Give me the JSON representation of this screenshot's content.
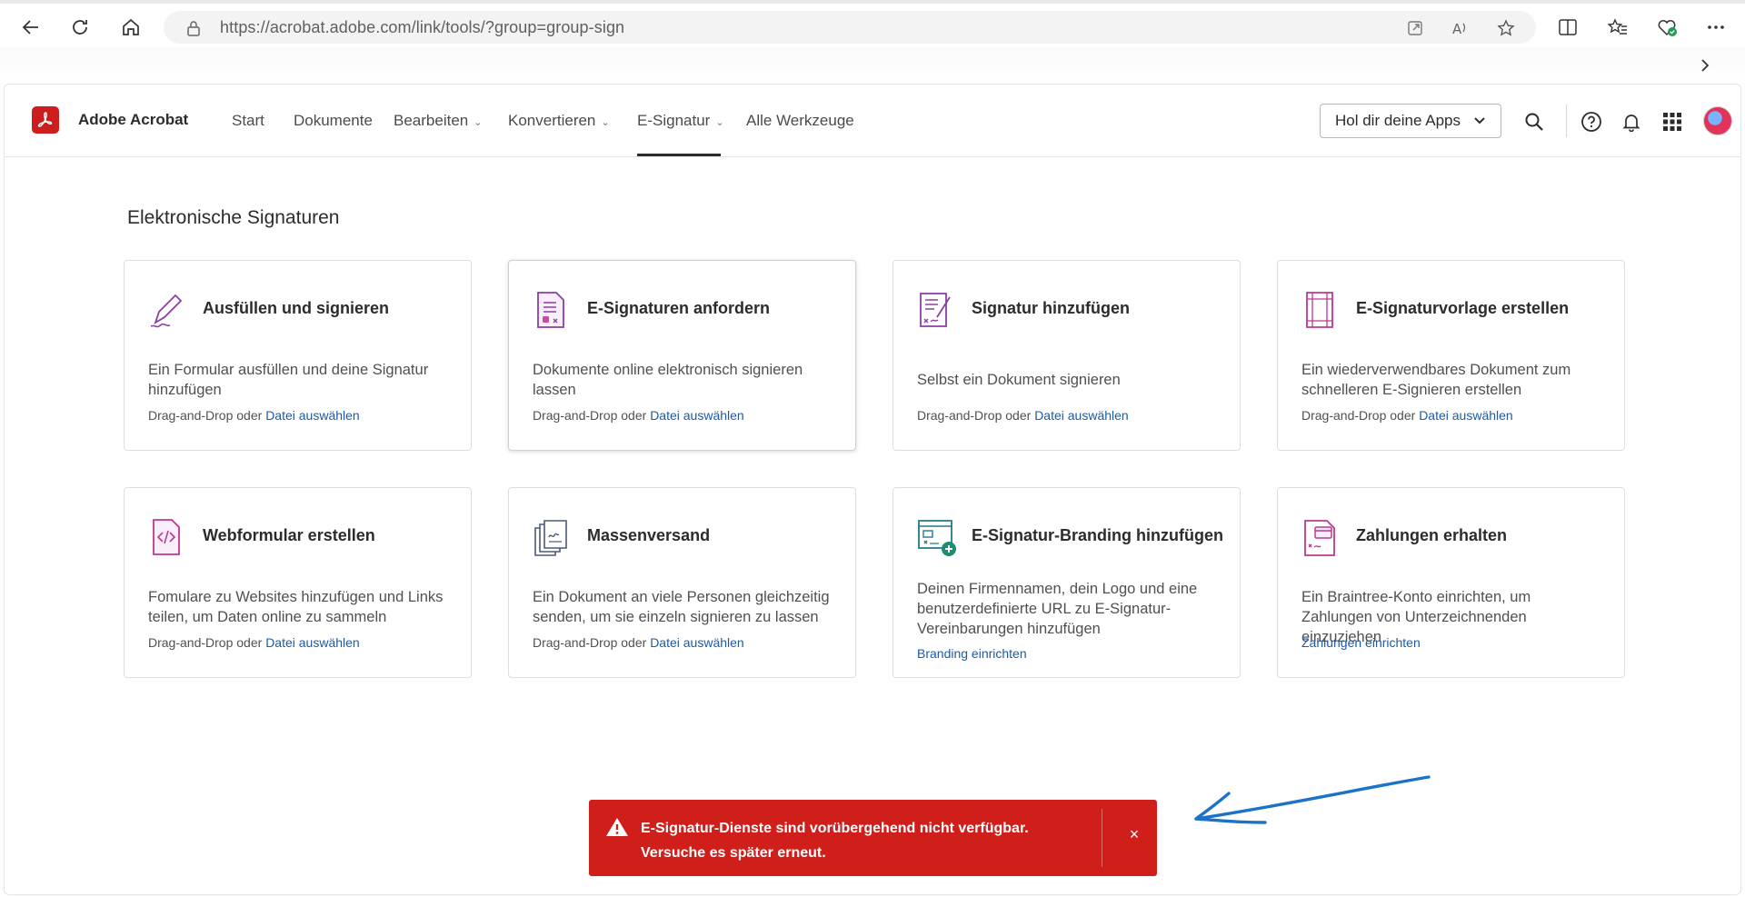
{
  "browser": {
    "url": "https://acrobat.adobe.com/link/tools/?group=group-sign"
  },
  "header": {
    "brand": "Adobe Acrobat",
    "menu": [
      {
        "label": "Start"
      },
      {
        "label": "Dokumente"
      },
      {
        "label": "Bearbeiten"
      },
      {
        "label": "Konvertieren"
      },
      {
        "label": "E-Signatur"
      },
      {
        "label": "Alle Werkzeuge"
      }
    ],
    "active_menu": "E-Signatur",
    "apps_button": "Hol dir deine Apps"
  },
  "main": {
    "section_title": "Elektronische Signaturen",
    "drag_text": "Drag-and-Drop oder",
    "cards": [
      {
        "title": "Ausfüllen und signieren",
        "desc": "Ein Formular ausfüllen und deine Signatur hinzufügen",
        "link": "Datei auswählen",
        "icon": "pen-sign-icon"
      },
      {
        "title": "E-Signaturen anfordern",
        "desc": "Dokumente online elektronisch signieren lassen",
        "link": "Datei auswählen",
        "icon": "request-signature-icon"
      },
      {
        "title": "Signatur hinzufügen",
        "desc": "Selbst ein Dokument signieren",
        "link": "Datei auswählen",
        "icon": "add-signature-icon"
      },
      {
        "title": "E-Signaturvorlage erstellen",
        "desc": "Ein wiederverwendbares Dokument zum schnelleren E-Signieren erstellen",
        "link": "Datei auswählen",
        "icon": "template-icon"
      },
      {
        "title": "Webformular erstellen",
        "desc": "Fomulare zu Websites hinzufügen und Links teilen, um Daten online zu sammeln",
        "link": "Datei auswählen",
        "icon": "web-form-icon"
      },
      {
        "title": "Massenversand",
        "desc": "Ein Dokument an viele Personen gleichzeitig senden, um sie einzeln signieren zu lassen",
        "link": "Datei auswählen",
        "icon": "bulk-send-icon"
      },
      {
        "title": "E-Signatur-Branding hinzufügen",
        "desc": "Deinen Firmennamen, dein Logo und eine benutzerdefinierte URL zu E-Signatur-Vereinbarungen hinzufügen",
        "link": "Branding einrichten",
        "icon": "branding-icon"
      },
      {
        "title": "Zahlungen erhalten",
        "desc": "Ein Braintree-Konto einrichten, um Zahlungen von Unterzeichnenden einzuziehen",
        "link": "Zahlungen einrichten",
        "icon": "payment-icon"
      }
    ]
  },
  "toast": {
    "message": "E-Signatur-Dienste sind vorübergehend nicht verfügbar. Versuche es später erneut.",
    "close": "×"
  },
  "colors": {
    "brand_red": "#cc1e1e",
    "toast_red": "#d01f1b",
    "link_blue": "#1b5aa8",
    "icon_purple": "#8a3fa3",
    "annotation_blue": "#1a73c9"
  }
}
